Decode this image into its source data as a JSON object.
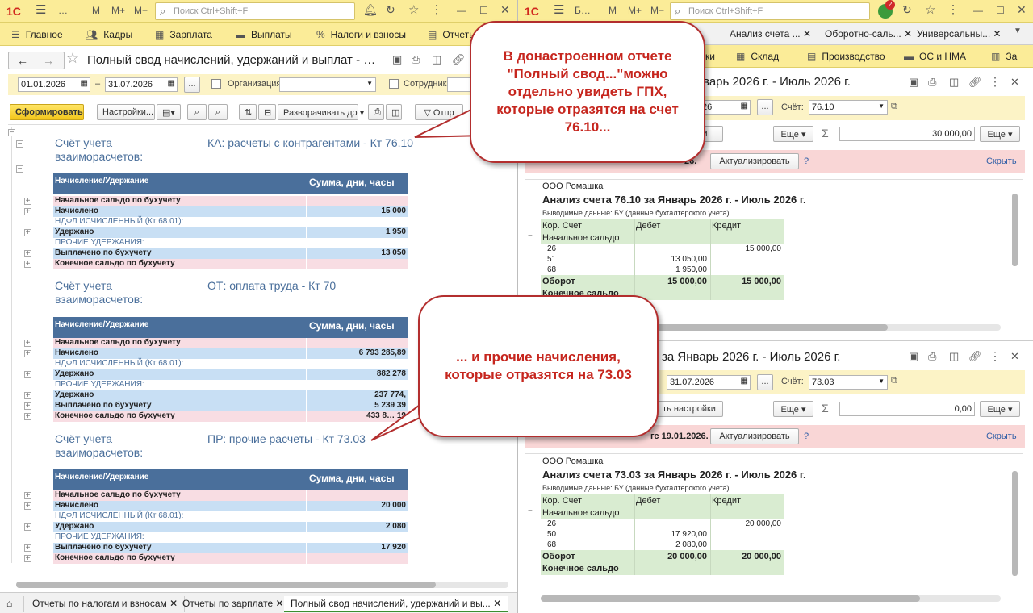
{
  "left_window": {
    "title_btns": [
      "…",
      "M",
      "M+",
      "M−"
    ],
    "search_placeholder": "Поиск Ctrl+Shift+F",
    "menu": [
      "Главное",
      "Кадры",
      "Зарплата",
      "Выплаты",
      "Налоги и взносы",
      "Отчеты"
    ],
    "doc_title": "Полный свод начислений, удержаний и выплат - …",
    "date_from": "01.01.2026",
    "date_dash": "–",
    "date_to": "31.07.2026",
    "ellipsis": "...",
    "org_label": "Организация:",
    "emp_label": "Сотрудник:",
    "btn_generate": "Сформировать",
    "btn_settings": "Настройки...",
    "btn_expand": "Разворачивать до",
    "btn_send": "Отпр",
    "col1": "Начисление/Удержание",
    "col2": "Сумма, дни, часы",
    "acc_label": "Счёт учета взаиморасчетов:",
    "sections": [
      {
        "title": "КА: расчеты с контрагентами - Кт 76.10",
        "rows": [
          [
            "Начальное сальдо по бухучету",
            ""
          ],
          [
            "Начислено",
            "15 000"
          ],
          [
            "НДФЛ ИСЧИСЛЕННЫЙ (Кт 68.01):",
            ""
          ],
          [
            "Удержано",
            "1 950"
          ],
          [
            "ПРОЧИЕ УДЕРЖАНИЯ:",
            ""
          ],
          [
            "Выплачено по бухучету",
            "13 050"
          ],
          [
            "Конечное сальдо по бухучету",
            ""
          ]
        ]
      },
      {
        "title": "ОТ: оплата труда - Кт 70",
        "rows": [
          [
            "Начальное сальдо по бухучету",
            ""
          ],
          [
            "Начислено",
            "6 793 285,89"
          ],
          [
            "НДФЛ ИСЧИСЛЕННЫЙ (Кт 68.01):",
            ""
          ],
          [
            "Удержано",
            "882 278"
          ],
          [
            "ПРОЧИЕ УДЕРЖАНИЯ:",
            ""
          ],
          [
            "Удержано",
            "237 774,"
          ],
          [
            "Выплачено по бухучету",
            "5 239 39"
          ],
          [
            "Конечное сальдо по бухучету",
            "433 8… 19"
          ]
        ]
      },
      {
        "title": "ПР: прочие расчеты - Кт 73.03",
        "rows": [
          [
            "Начальное сальдо по бухучету",
            ""
          ],
          [
            "Начислено",
            "20 000"
          ],
          [
            "НДФЛ ИСЧИСЛЕННЫЙ (Кт 68.01):",
            ""
          ],
          [
            "Удержано",
            "2 080"
          ],
          [
            "ПРОЧИЕ УДЕРЖАНИЯ:",
            ""
          ],
          [
            "Выплачено по бухучету",
            "17 920"
          ],
          [
            "Конечное сальдо по бухучету",
            ""
          ]
        ]
      }
    ],
    "bottom_tabs": [
      "Отчеты по налогам и взносам",
      "Отчеты по зарплате",
      "Полный свод начислений, удержаний и вы..."
    ]
  },
  "right_window": {
    "title_btns": [
      "Б…",
      "M",
      "M+",
      "M−"
    ],
    "search_placeholder": "Поиск Ctrl+Shift+F",
    "tabs": [
      "Анализ счета ...",
      "Оборотно-саль...",
      "Универсальны..."
    ],
    "menu": [
      "Склад",
      "Производство",
      "ОС и НМА",
      "За"
    ],
    "menu_partial": "ки",
    "top": {
      "title": "0 за Январь 2026 г. - Июль 2026 г.",
      "date_partial": "26",
      "account_label": "Счёт:",
      "account": "76.10",
      "more": "Еще",
      "sum": "30 000,00",
      "notice_partial": "26.",
      "btn_update": "Актуализировать",
      "hide": "Скрыть",
      "q": "?",
      "org": "ООО Ромашка",
      "report_title": "Анализ счета 76.10 за Январь 2026 г. - Июль 2026 г.",
      "sub": "Выводимые данные: БУ (данные бухгалтерского учета)",
      "cols": [
        "Кор. Счет",
        "Дебет",
        "Кредит"
      ],
      "open": "Начальное сальдо",
      "rows": [
        [
          "26",
          "",
          "15 000,00"
        ],
        [
          "51",
          "13 050,00",
          ""
        ],
        [
          "68",
          "1 950,00",
          ""
        ]
      ],
      "turn": [
        "Оборот",
        "15 000,00",
        "15 000,00"
      ],
      "close": "Конечное сальдо"
    },
    "bottom": {
      "title": "за Январь 2026 г. - Июль 2026 г.",
      "date_to": "31.07.2026",
      "account_label": "Счёт:",
      "account": "73.03",
      "btn_settings": "ть настройки",
      "more": "Еще",
      "sum": "0,00",
      "notice_partial": "гс 19.01.2026.",
      "btn_update": "Актуализировать",
      "hide": "Скрыть",
      "q": "?",
      "org": "ООО Ромашка",
      "report_title": "Анализ счета 73.03 за Январь 2026 г. - Июль 2026 г.",
      "sub": "Выводимые данные: БУ (данные бухгалтерского учета)",
      "cols": [
        "Кор. Счет",
        "Дебет",
        "Кредит"
      ],
      "open": "Начальное сальдо",
      "rows": [
        [
          "26",
          "",
          "20 000,00"
        ],
        [
          "50",
          "17 920,00",
          ""
        ],
        [
          "68",
          "2 080,00",
          ""
        ]
      ],
      "turn": [
        "Оборот",
        "20 000,00",
        "20 000,00"
      ],
      "close": "Конечное сальдо"
    }
  },
  "callouts": {
    "first": "В донастроенном отчете \"Полный свод...\"можно отдельно увидеть ГПХ, которые отразятся на счет 76.10...",
    "second": "... и прочие начисления, которые отразятся на 73.03"
  },
  "colors": {
    "header_yellow": "#fbec98",
    "table_blue": "#4a6f9b",
    "row_pink": "#f8dde3",
    "row_blue": "#c8dff4",
    "callout_red": "#c6261e",
    "green": "#d9ecd1"
  }
}
